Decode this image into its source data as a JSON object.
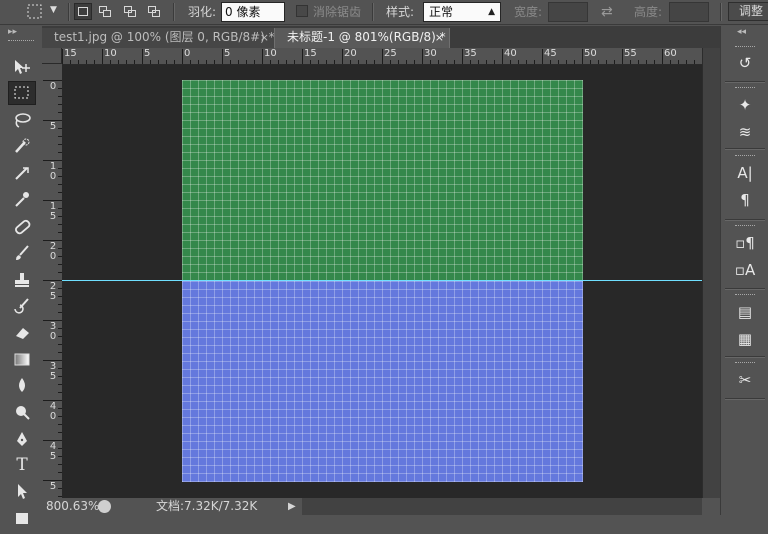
{
  "options_bar": {
    "feather_label": "羽化:",
    "feather_value": "0 像素",
    "antialias_label": "消除锯齿",
    "style_label": "样式:",
    "style_value": "正常",
    "width_label": "宽度:",
    "height_label": "高度:",
    "adjust_edge_button": "调整"
  },
  "tabs": [
    {
      "label": "test1.jpg @ 100% (图层 0, RGB/8#) *",
      "close": "×",
      "active": false
    },
    {
      "label": "未标题-1 @ 801%(RGB/8) *",
      "close": "×",
      "active": true
    }
  ],
  "h_ruler_labels": [
    "15",
    "10",
    "5",
    "0",
    "5",
    "10",
    "15",
    "20",
    "25",
    "30",
    "35",
    "40",
    "45",
    "50",
    "55",
    "60"
  ],
  "v_ruler_labels": [
    "0",
    "5",
    "1 0",
    "1 5",
    "2 0",
    "2 5",
    "3 0",
    "3 5",
    "4 0",
    "4 5",
    "5"
  ],
  "status": {
    "zoom": "800.63%",
    "doc_info": "文档:7.32K/7.32K",
    "arrow": "▶"
  },
  "colors": {
    "top_fill": "#34884b",
    "bottom_fill": "#6478dd",
    "guide": "#6fe0ff",
    "workspace": "#282828",
    "ui_gray": "#535353"
  },
  "tools": [
    "move-tool-icon",
    "rect-marquee-tool-icon",
    "lasso-tool-icon",
    "quick-selection-tool-icon",
    "crop-tool-icon",
    "eyedropper-tool-icon",
    "spot-healing-tool-icon",
    "brush-tool-icon",
    "clone-stamp-tool-icon",
    "history-brush-tool-icon",
    "eraser-tool-icon",
    "gradient-tool-icon",
    "blur-tool-icon",
    "dodge-tool-icon",
    "pen-tool-icon",
    "type-tool-icon",
    "path-selection-tool-icon"
  ],
  "right_panel_icons": [
    "history-panel-icon",
    "brushes-panel-icon",
    "brush-presets-panel-icon",
    "character-panel-icon",
    "paragraph-panel-icon",
    "character-styles-panel-icon",
    "paragraph-styles-panel-icon",
    "notes-panel-icon",
    "properties-panel-icon",
    "tool-presets-panel-icon"
  ]
}
